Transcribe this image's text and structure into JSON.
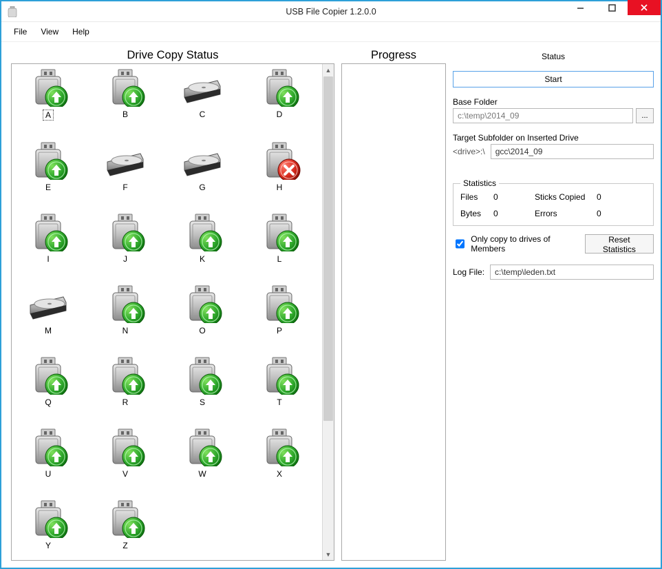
{
  "window": {
    "title": "USB File Copier 1.2.0.0",
    "controls": {
      "minimize": "—",
      "maximize": "▢",
      "close": "✕"
    }
  },
  "menu": {
    "file": "File",
    "view": "View",
    "help": "Help"
  },
  "left_panel_title": "Drive Copy Status",
  "mid_panel_title": "Progress",
  "right": {
    "status_label": "Status",
    "start_button": "Start",
    "base_folder_label": "Base Folder",
    "base_folder_value": "c:\\temp\\2014_09",
    "browse_button": "...",
    "target_subfolder_label": "Target Subfolder on Inserted Drive",
    "target_prefix": "<drive>:\\",
    "target_subfolder_value": "gcc\\2014_09",
    "statistics_legend": "Statistics",
    "stat_files_label": "Files",
    "stat_files_value": "0",
    "stat_sticks_label": "Sticks Copied",
    "stat_sticks_value": "0",
    "stat_bytes_label": "Bytes",
    "stat_bytes_value": "0",
    "stat_errors_label": "Errors",
    "stat_errors_value": "0",
    "only_members_label": "Only copy to drives of Members",
    "only_members_checked": true,
    "reset_button": "Reset Statistics",
    "log_file_label": "Log File:",
    "log_file_value": "c:\\temp\\leden.txt"
  },
  "drives": [
    {
      "letter": "A",
      "type": "usb",
      "status": "upload",
      "selected": true
    },
    {
      "letter": "B",
      "type": "usb",
      "status": "upload"
    },
    {
      "letter": "C",
      "type": "disk",
      "status": "none"
    },
    {
      "letter": "D",
      "type": "usb",
      "status": "upload"
    },
    {
      "letter": "E",
      "type": "usb",
      "status": "upload"
    },
    {
      "letter": "F",
      "type": "disk",
      "status": "none"
    },
    {
      "letter": "G",
      "type": "disk",
      "status": "none"
    },
    {
      "letter": "H",
      "type": "usb",
      "status": "error"
    },
    {
      "letter": "I",
      "type": "usb",
      "status": "upload"
    },
    {
      "letter": "J",
      "type": "usb",
      "status": "upload"
    },
    {
      "letter": "K",
      "type": "usb",
      "status": "upload"
    },
    {
      "letter": "L",
      "type": "usb",
      "status": "upload"
    },
    {
      "letter": "M",
      "type": "disk",
      "status": "none"
    },
    {
      "letter": "N",
      "type": "usb",
      "status": "upload"
    },
    {
      "letter": "O",
      "type": "usb",
      "status": "upload"
    },
    {
      "letter": "P",
      "type": "usb",
      "status": "upload"
    },
    {
      "letter": "Q",
      "type": "usb",
      "status": "upload"
    },
    {
      "letter": "R",
      "type": "usb",
      "status": "upload"
    },
    {
      "letter": "S",
      "type": "usb",
      "status": "upload"
    },
    {
      "letter": "T",
      "type": "usb",
      "status": "upload"
    },
    {
      "letter": "U",
      "type": "usb",
      "status": "upload"
    },
    {
      "letter": "V",
      "type": "usb",
      "status": "upload"
    },
    {
      "letter": "W",
      "type": "usb",
      "status": "upload"
    },
    {
      "letter": "X",
      "type": "usb",
      "status": "upload"
    },
    {
      "letter": "Y",
      "type": "usb",
      "status": "upload"
    },
    {
      "letter": "Z",
      "type": "usb",
      "status": "upload"
    }
  ]
}
